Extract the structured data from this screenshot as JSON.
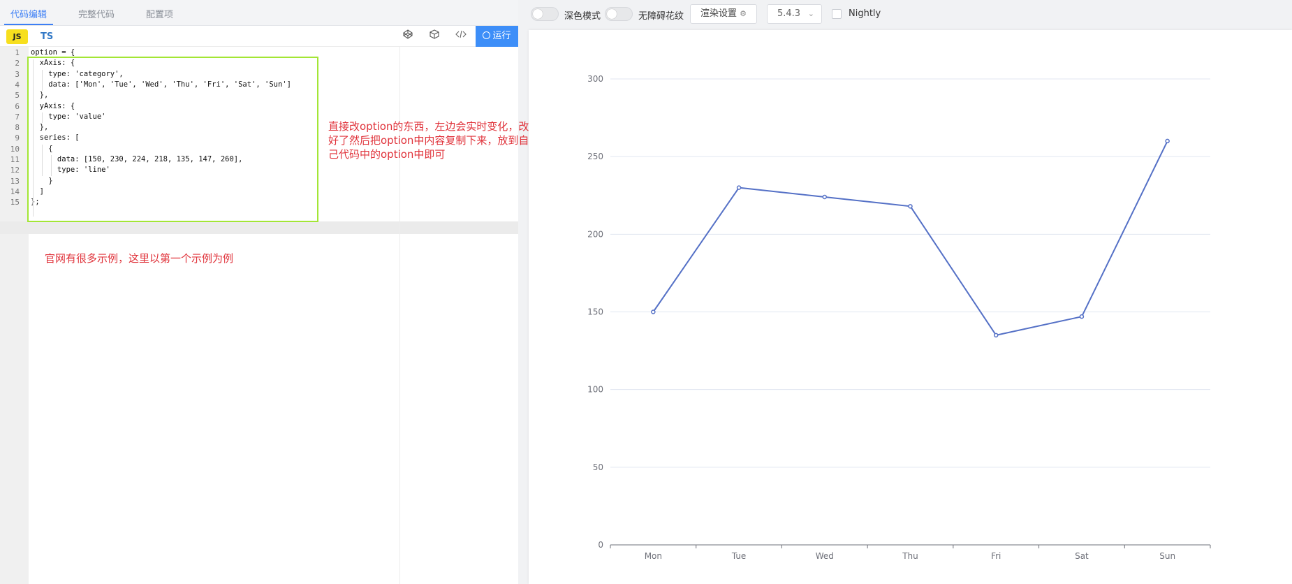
{
  "tabs": [
    {
      "label": "代码编辑",
      "active": true
    },
    {
      "label": "完整代码",
      "active": false
    },
    {
      "label": "配置项",
      "active": false
    }
  ],
  "toolbar": {
    "lang_js": "JS",
    "lang_ts": "TS",
    "icons": [
      "codepen-icon",
      "codesandbox-icon",
      "code-icon"
    ],
    "run_label": "运行"
  },
  "editor": {
    "line_numbers": [
      "1",
      "2",
      "3",
      "4",
      "5",
      "6",
      "7",
      "8",
      "9",
      "10",
      "11",
      "12",
      "13",
      "14",
      "15"
    ],
    "lines": [
      "option = {",
      "  xAxis: {",
      "    type: 'category',",
      "    data: ['Mon', 'Tue', 'Wed', 'Thu', 'Fri', 'Sat', 'Sun']",
      "  },",
      "  yAxis: {",
      "    type: 'value'",
      "  },",
      "  series: [",
      "    {",
      "      data: [150, 230, 224, 218, 135, 147, 260],",
      "      type: 'line'",
      "    }",
      "  ]",
      "};"
    ],
    "cursor_line": 15
  },
  "annotations": {
    "note1": "直接改option的东西，左边会实时变化，改好了然后把option中内容复制下来，放到自己代码中的option中即可",
    "note2": "官网有很多示例，这里以第一个示例为例",
    "color": "#e0323a",
    "box_color": "#a3e635"
  },
  "right_toolbar": {
    "dark_mode_label": "深色模式",
    "aria_label": "无障碍花纹",
    "render_label": "渲染设置",
    "version": "5.4.3",
    "nightly_label": "Nightly"
  },
  "chart_data": {
    "type": "line",
    "categories": [
      "Mon",
      "Tue",
      "Wed",
      "Thu",
      "Fri",
      "Sat",
      "Sun"
    ],
    "series": [
      {
        "values": [
          150,
          230,
          224,
          218,
          135,
          147,
          260
        ]
      }
    ],
    "y_ticks": [
      0,
      50,
      100,
      150,
      200,
      250,
      300
    ],
    "ylim": [
      0,
      300
    ],
    "grid": true,
    "color": "#5470c6"
  }
}
